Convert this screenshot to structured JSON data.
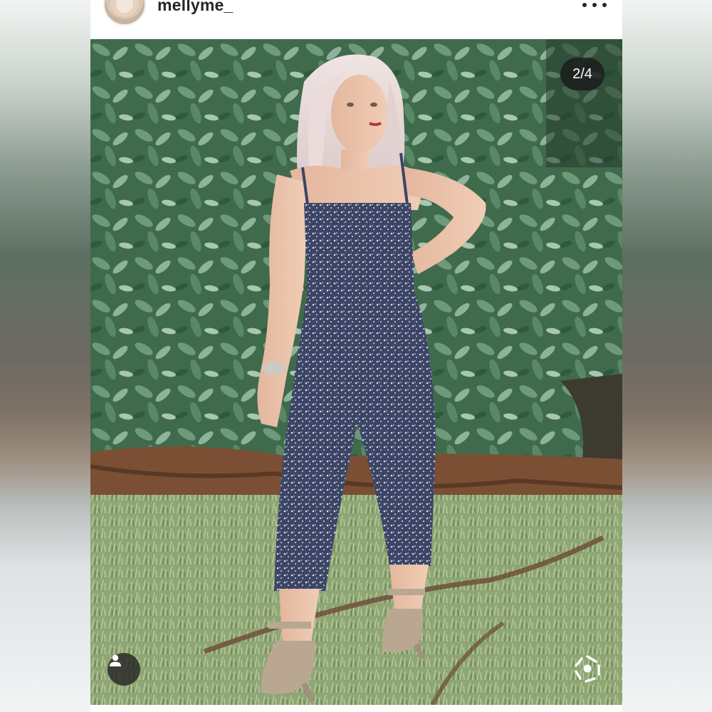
{
  "post": {
    "username": "mellyme_",
    "image_counter": "2/4"
  },
  "icons": {
    "more": "more-horizontal-icon",
    "tag": "person-tag-icon",
    "lens": "visual-search-icon"
  },
  "colors": {
    "badge_bg": "#1a1a1a",
    "text": "#262626",
    "foliage": "#4c7a5a",
    "jumpsuit": "#4a5478"
  }
}
